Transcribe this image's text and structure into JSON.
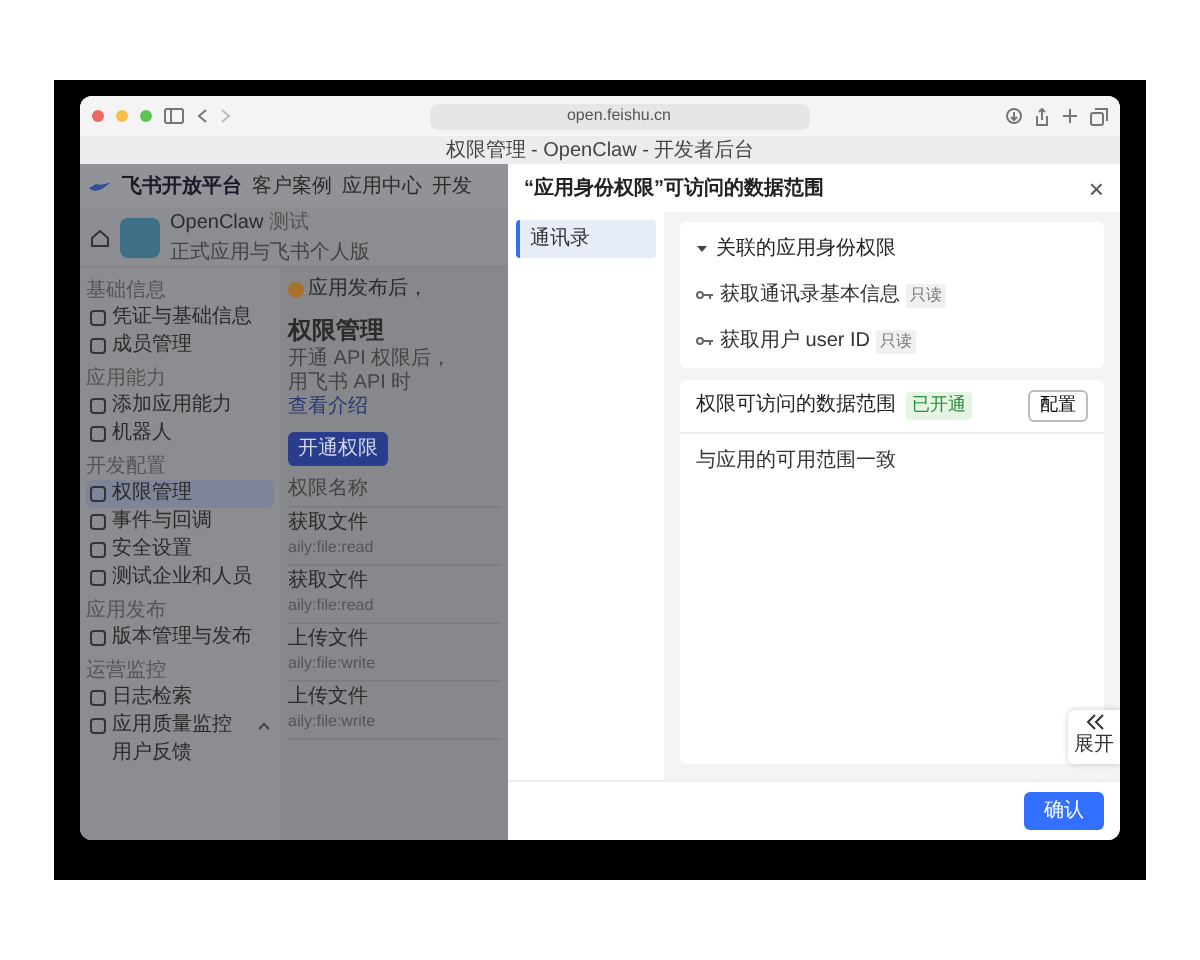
{
  "browser": {
    "url": "open.feishu.cn",
    "tab_title": "权限管理 - OpenClaw - 开发者后台"
  },
  "background_page": {
    "logo": "飞书开放平台",
    "nav": [
      "客户案例",
      "应用中心",
      "开发"
    ],
    "app": {
      "name": "OpenClaw",
      "tag": "测试",
      "subtitle": "正式应用与飞书个人版"
    },
    "notice": "应用发布后，",
    "sidebar": [
      {
        "heading": "基础信息",
        "items": [
          {
            "label": "凭证与基础信息",
            "selected": false
          },
          {
            "label": "成员管理",
            "selected": false
          }
        ]
      },
      {
        "heading": "应用能力",
        "items": [
          {
            "label": "添加应用能力",
            "selected": false
          },
          {
            "label": "机器人",
            "selected": false
          }
        ]
      },
      {
        "heading": "开发配置",
        "items": [
          {
            "label": "权限管理",
            "selected": true
          },
          {
            "label": "事件与回调",
            "selected": false
          },
          {
            "label": "安全设置",
            "selected": false
          },
          {
            "label": "测试企业和人员",
            "selected": false
          }
        ]
      },
      {
        "heading": "应用发布",
        "items": [
          {
            "label": "版本管理与发布",
            "selected": false
          }
        ]
      },
      {
        "heading": "运营监控",
        "items": [
          {
            "label": "日志检索",
            "selected": false
          },
          {
            "label": "应用质量监控",
            "selected": false,
            "expanded": true,
            "children": [
              {
                "label": "用户反馈",
                "selected": false
              }
            ]
          }
        ]
      }
    ],
    "main": {
      "title": "权限管理",
      "description": [
        "开通 API 权限后，",
        "用飞书 API 时"
      ],
      "toggle": "查看介绍",
      "button": "开通权限",
      "column": "权限名称",
      "rows": [
        {
          "name": "获取文件",
          "scope": "aily:file:read"
        },
        {
          "name": "获取文件",
          "scope": "aily:file:read"
        },
        {
          "name": "上传文件",
          "scope": "aily:file:write"
        },
        {
          "name": "上传文件",
          "scope": "aily:file:write"
        }
      ]
    }
  },
  "modal": {
    "title": "“应用身份权限”可访问的数据范围",
    "close": "×",
    "categories": [
      {
        "label": "通讯录",
        "selected": true
      }
    ],
    "related": {
      "title": "关联的应用身份权限",
      "expanded": true,
      "permissions": [
        {
          "label": "获取通讯录基本信息",
          "tag": "只读"
        },
        {
          "label": "获取用户 user ID",
          "tag": "只读"
        }
      ]
    },
    "scope": {
      "title": "权限可访问的数据范围",
      "status": "已开通",
      "button": "配置",
      "text": "与应用的可用范围一致"
    },
    "side_tab": "展开",
    "confirm": "确认"
  }
}
